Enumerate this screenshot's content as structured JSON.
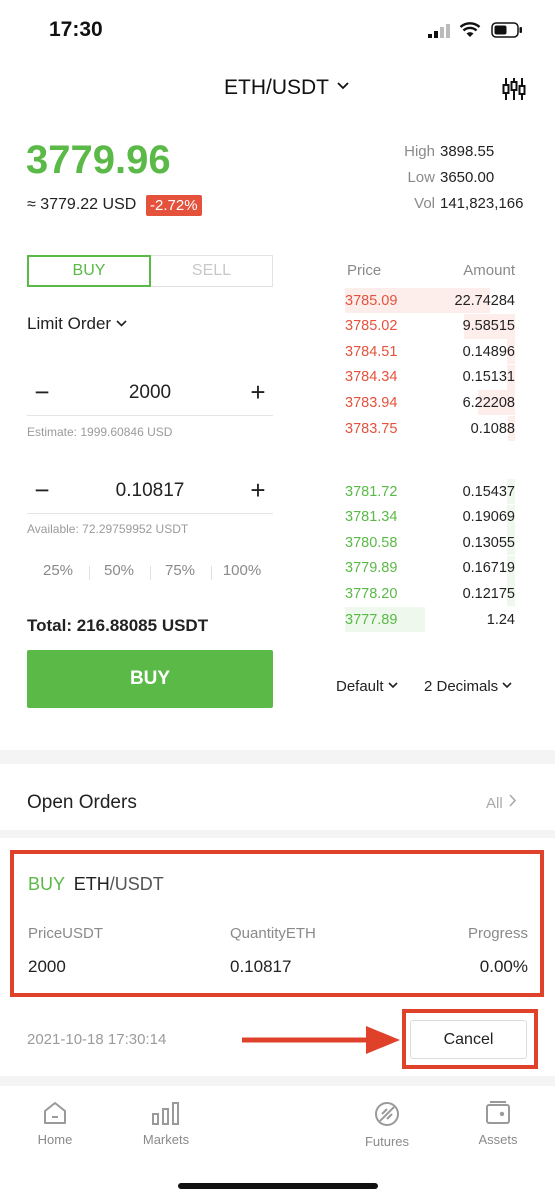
{
  "status_bar": {
    "time": "17:30"
  },
  "header": {
    "pair": "ETH/USDT",
    "chevron": "⌄"
  },
  "ticker": {
    "price": "3779.96",
    "usd_equiv": "≈ 3779.22 USD",
    "change": "-2.72%",
    "high_label": "High",
    "high_value": "3898.55",
    "low_label": "Low",
    "low_value": "3650.00",
    "vol_label": "Vol",
    "vol_value": "141,823,166"
  },
  "trade_form": {
    "buy_tab": "BUY",
    "sell_tab": "SELL",
    "order_type": "Limit Order",
    "price_value": "2000",
    "estimate": "Estimate: 1999.60846 USD",
    "quantity_value": "0.10817",
    "available": "Available: 72.29759952 USDT",
    "percents": [
      "25%",
      "50%",
      "75%",
      "100%"
    ],
    "total": "Total: 216.88085 USDT",
    "submit": "BUY",
    "minus": "−",
    "plus": "+"
  },
  "order_book": {
    "price_header": "Price",
    "amount_header": "Amount",
    "asks": [
      {
        "price": "3785.09",
        "amount": "22.74284",
        "depth": 0.85
      },
      {
        "price": "3785.02",
        "amount": "9.58515",
        "depth": 0.3
      },
      {
        "price": "3784.51",
        "amount": "0.14896",
        "depth": 0.05
      },
      {
        "price": "3784.34",
        "amount": "0.15131",
        "depth": 0.05
      },
      {
        "price": "3783.94",
        "amount": "6.22208",
        "depth": 0.22
      },
      {
        "price": "3783.75",
        "amount": "0.1088",
        "depth": 0.04
      }
    ],
    "bids": [
      {
        "price": "3781.72",
        "amount": "0.15437",
        "depth": 0.05
      },
      {
        "price": "3781.34",
        "amount": "0.19069",
        "depth": 0.05
      },
      {
        "price": "3780.58",
        "amount": "0.13055",
        "depth": 0.05
      },
      {
        "price": "3779.89",
        "amount": "0.16719",
        "depth": 0.05
      },
      {
        "price": "3778.20",
        "amount": "0.12175",
        "depth": 0.05
      },
      {
        "price": "3777.89",
        "amount": "1.24",
        "depth": 0.47
      }
    ],
    "grouping": "Default",
    "decimals": "2 Decimals"
  },
  "open_orders": {
    "title": "Open Orders",
    "all_link": "All",
    "order": {
      "side": "BUY",
      "base": "ETH",
      "quote": "/USDT",
      "price_label": "PriceUSDT",
      "price_value": "2000",
      "qty_label": "QuantityETH",
      "qty_value": "0.10817",
      "progress_label": "Progress",
      "progress_value": "0.00%",
      "timestamp": "2021-10-18 17:30:14",
      "cancel": "Cancel"
    }
  },
  "bottom_nav": [
    {
      "label": "Home",
      "icon": "home-icon"
    },
    {
      "label": "Markets",
      "icon": "bar-chart-icon"
    },
    {
      "label": "Futures",
      "icon": "futures-icon"
    },
    {
      "label": "Assets",
      "icon": "wallet-icon"
    }
  ],
  "colors": {
    "green": "#5ab947",
    "red": "#e5523b",
    "highlight": "#e0412b"
  }
}
